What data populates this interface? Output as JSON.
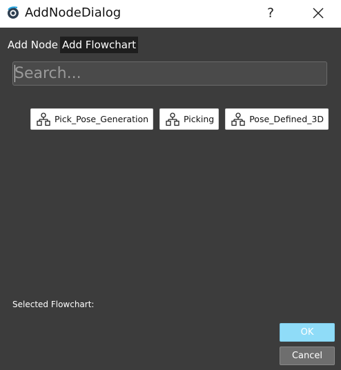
{
  "window": {
    "title": "AddNodeDialog",
    "help_label": "?",
    "app_icon": "eye-logo-icon",
    "close_icon": "close-icon"
  },
  "tabs": [
    {
      "label": "Add Node",
      "active": false
    },
    {
      "label": "Add Flowchart",
      "active": true
    }
  ],
  "search": {
    "placeholder": "Search...",
    "value": ""
  },
  "nodes": [
    {
      "label": "Pick_Pose_Generation",
      "icon": "flowchart-icon"
    },
    {
      "label": "Picking",
      "icon": "flowchart-icon"
    },
    {
      "label": "Pose_Defined_3D",
      "icon": "flowchart-icon"
    }
  ],
  "selected_label": "Selected Flowchart:",
  "buttons": {
    "ok": "OK",
    "cancel": "Cancel"
  },
  "colors": {
    "background": "#3c3c3c",
    "accent": "#8fdcf8",
    "active_tab": "#1e1e1e"
  }
}
